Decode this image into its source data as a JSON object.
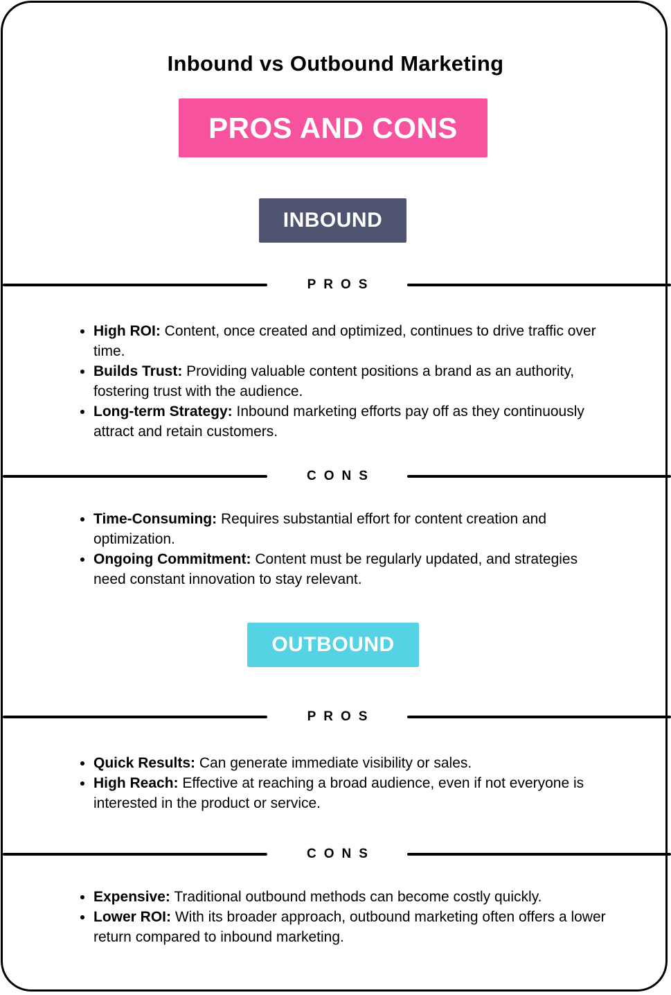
{
  "title": "Inbound vs Outbound Marketing",
  "banner": "PROS AND CONS",
  "colors": {
    "banner_bg": "#f7529d",
    "inbound_bg": "#4e5370",
    "outbound_bg": "#55d2e3",
    "text": "#000000"
  },
  "sections": [
    {
      "tag": "INBOUND",
      "pros_label": "PROS",
      "pros": [
        {
          "term": "High ROI:",
          "text": " Content, once created and optimized, continues to drive traffic over time."
        },
        {
          "term": "Builds Trust:",
          "text": " Providing valuable content positions a brand as an authority, fostering trust with the audience."
        },
        {
          "term": "Long-term Strategy:",
          "text": " Inbound marketing efforts pay off as they continuously attract and retain customers."
        }
      ],
      "cons_label": "CONS",
      "cons": [
        {
          "term": "Time-Consuming:",
          "text": " Requires substantial effort for content creation and optimization."
        },
        {
          "term": "Ongoing Commitment:",
          "text": " Content must be regularly updated, and strategies need constant innovation to stay relevant."
        }
      ]
    },
    {
      "tag": "OUTBOUND",
      "pros_label": "PROS",
      "pros": [
        {
          "term": "Quick Results:",
          "text": " Can generate immediate visibility or sales."
        },
        {
          "term": "High Reach:",
          "text": " Effective at reaching a broad audience, even if not everyone is interested in the product or service."
        }
      ],
      "cons_label": "CONS",
      "cons": [
        {
          "term": "Expensive:",
          "text": " Traditional outbound methods can become costly quickly."
        },
        {
          "term": "Lower ROI:",
          "text": " With its broader approach, outbound marketing often offers a lower return compared to inbound marketing."
        }
      ]
    }
  ]
}
